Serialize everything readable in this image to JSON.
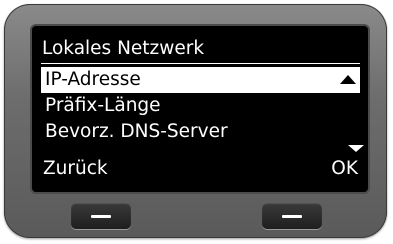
{
  "screen": {
    "title": "Lokales Netzwerk",
    "menu_items": [
      {
        "label": "IP-Adresse",
        "selected": true
      },
      {
        "label": "Präfix-Länge",
        "selected": false
      },
      {
        "label": "Bevorz. DNS-Server",
        "selected": false
      }
    ],
    "softkeys": {
      "left": "Zurück",
      "right": "OK"
    },
    "scroll": {
      "up_icon": "triangle-up-icon",
      "down_icon": "triangle-down-icon"
    }
  },
  "hardware_keys": {
    "left_icon": "dash-icon",
    "right_icon": "dash-icon"
  },
  "colors": {
    "screen_bg": "#000000",
    "text": "#ffffff",
    "selection_bg": "#ffffff",
    "device_body": "#6d6d6d"
  }
}
